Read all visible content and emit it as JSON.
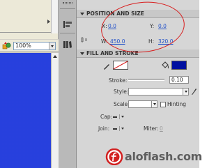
{
  "stage": {
    "zoom_value": "100%"
  },
  "position_size": {
    "header": "POSITION AND SIZE",
    "x_label": "X:",
    "x_value": "0.0",
    "y_label": "Y:",
    "y_value": "0.0",
    "w_label": "W:",
    "w_value": "450.0",
    "h_label": "H:",
    "h_value": "320.0"
  },
  "fill_stroke": {
    "header": "FILL AND STROKE",
    "stroke_label": "Stroke:",
    "stroke_value": "0.10",
    "style_label": "Style:",
    "style_value": "",
    "scale_label": "Scale:",
    "scale_value": "",
    "hinting_label": "Hinting",
    "cap_label": "Cap:",
    "join_label": "Join:",
    "miter_label": "Miter:",
    "miter_value": "0",
    "fill_color": "#0010a0",
    "annotation_color": "#d81e1e"
  },
  "watermark": {
    "text": "aloflash.com"
  }
}
